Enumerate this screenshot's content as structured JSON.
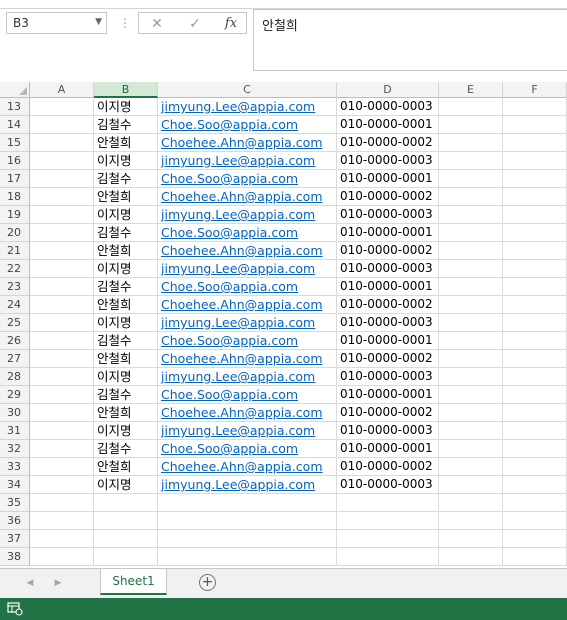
{
  "formula_bar": {
    "name_box": "B3",
    "cancel_icon": "✕",
    "enter_icon": "✓",
    "fx_icon": "fx",
    "content": "안철희"
  },
  "columns": [
    "A",
    "B",
    "C",
    "D",
    "E",
    "F"
  ],
  "selected_column": "B",
  "rows": [
    {
      "num": "13",
      "name": "이지명",
      "email": "jimyung.Lee@appia.com",
      "phone": "010-0000-0003"
    },
    {
      "num": "14",
      "name": "김철수",
      "email": "Choe.Soo@appia.com",
      "phone": "010-0000-0001"
    },
    {
      "num": "15",
      "name": "안철희",
      "email": "Choehee.Ahn@appia.com",
      "phone": "010-0000-0002"
    },
    {
      "num": "16",
      "name": "이지명",
      "email": "jimyung.Lee@appia.com",
      "phone": "010-0000-0003"
    },
    {
      "num": "17",
      "name": "김철수",
      "email": "Choe.Soo@appia.com",
      "phone": "010-0000-0001"
    },
    {
      "num": "18",
      "name": "안철희",
      "email": "Choehee.Ahn@appia.com",
      "phone": "010-0000-0002"
    },
    {
      "num": "19",
      "name": "이지명",
      "email": "jimyung.Lee@appia.com",
      "phone": "010-0000-0003"
    },
    {
      "num": "20",
      "name": "김철수",
      "email": "Choe.Soo@appia.com",
      "phone": "010-0000-0001"
    },
    {
      "num": "21",
      "name": "안철희",
      "email": "Choehee.Ahn@appia.com",
      "phone": "010-0000-0002"
    },
    {
      "num": "22",
      "name": "이지명",
      "email": "jimyung.Lee@appia.com",
      "phone": "010-0000-0003"
    },
    {
      "num": "23",
      "name": "김철수",
      "email": "Choe.Soo@appia.com",
      "phone": "010-0000-0001"
    },
    {
      "num": "24",
      "name": "안철희",
      "email": "Choehee.Ahn@appia.com",
      "phone": "010-0000-0002"
    },
    {
      "num": "25",
      "name": "이지명",
      "email": "jimyung.Lee@appia.com",
      "phone": "010-0000-0003"
    },
    {
      "num": "26",
      "name": "김철수",
      "email": "Choe.Soo@appia.com",
      "phone": "010-0000-0001"
    },
    {
      "num": "27",
      "name": "안철희",
      "email": "Choehee.Ahn@appia.com",
      "phone": "010-0000-0002"
    },
    {
      "num": "28",
      "name": "이지명",
      "email": "jimyung.Lee@appia.com",
      "phone": "010-0000-0003"
    },
    {
      "num": "29",
      "name": "김철수",
      "email": "Choe.Soo@appia.com",
      "phone": "010-0000-0001"
    },
    {
      "num": "30",
      "name": "안철희",
      "email": "Choehee.Ahn@appia.com",
      "phone": "010-0000-0002"
    },
    {
      "num": "31",
      "name": "이지명",
      "email": "jimyung.Lee@appia.com",
      "phone": "010-0000-0003"
    },
    {
      "num": "32",
      "name": "김철수",
      "email": "Choe.Soo@appia.com",
      "phone": "010-0000-0001"
    },
    {
      "num": "33",
      "name": "안철희",
      "email": "Choehee.Ahn@appia.com",
      "phone": "010-0000-0002"
    },
    {
      "num": "34",
      "name": "이지명",
      "email": "jimyung.Lee@appia.com",
      "phone": "010-0000-0003"
    },
    {
      "num": "35",
      "name": "",
      "email": "",
      "phone": ""
    },
    {
      "num": "36",
      "name": "",
      "email": "",
      "phone": ""
    },
    {
      "num": "37",
      "name": "",
      "email": "",
      "phone": ""
    },
    {
      "num": "38",
      "name": "",
      "email": "",
      "phone": ""
    }
  ],
  "sheet_tabs": [
    "Sheet1"
  ],
  "add_sheet_icon": "+",
  "nav_icons": {
    "left": "◀",
    "right": "▶"
  },
  "colors": {
    "accent_green": "#217346",
    "hyperlink": "#0563c1",
    "selected_header_bg": "#d3e9d6"
  },
  "icons": {
    "name_box_dropdown": "chevron-down-icon",
    "status": "cell-mode-icon"
  }
}
